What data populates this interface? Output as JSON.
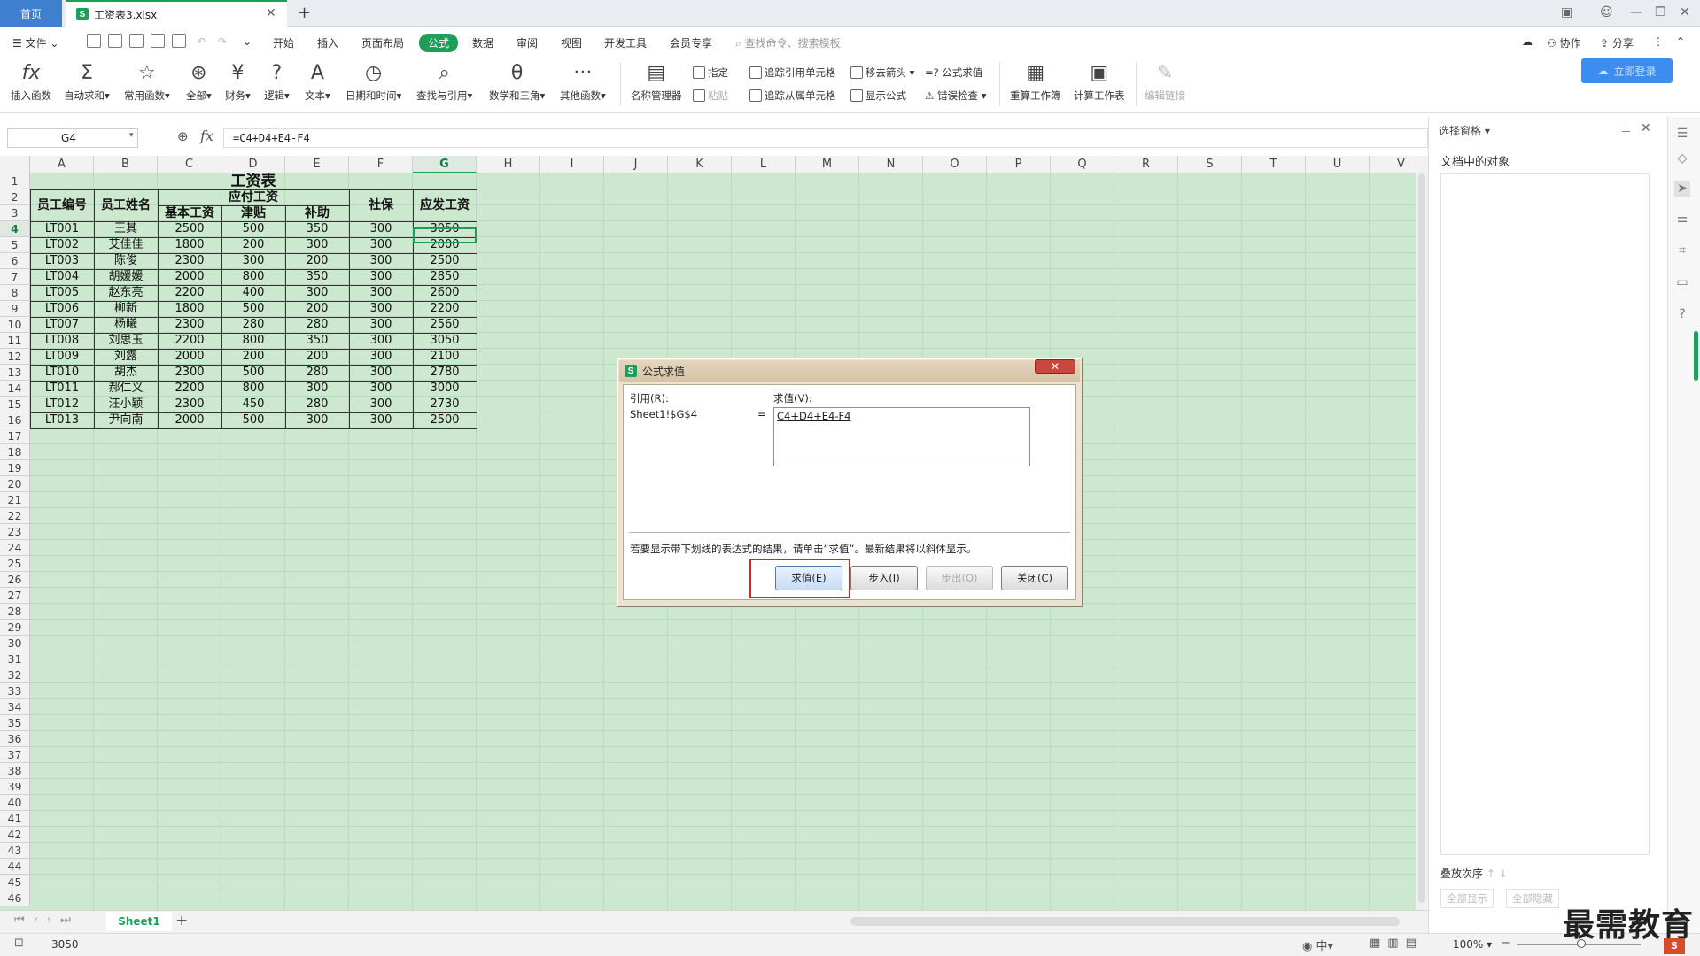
{
  "tabs": {
    "home": "首页",
    "file": "工资表3.xlsx"
  },
  "menu": {
    "file": "文件",
    "items": [
      "开始",
      "插入",
      "页面布局",
      "公式",
      "数据",
      "审阅",
      "视图",
      "开发工具",
      "会员专享"
    ],
    "active": "公式",
    "search": "查找命令、搜索模板",
    "collab": "协作",
    "share": "分享"
  },
  "ribbon": {
    "big": [
      "插入函数",
      "自动求和",
      "常用函数",
      "全部",
      "财务",
      "逻辑",
      "文本",
      "日期和时间",
      "查找与引用",
      "数学和三角",
      "其他函数",
      "名称管理器"
    ],
    "small": {
      "assign": "指定",
      "paste": "粘贴",
      "trace_prec": "追踪引用单元格",
      "trace_dep": "追踪从属单元格",
      "remove_arrows": "移去箭头",
      "show_formula": "显示公式",
      "eval_formula": "=? 公式求值",
      "error_check": "错误检查"
    },
    "calc": [
      "重算工作簿",
      "计算工作表"
    ],
    "edit_links": "编辑链接",
    "login": "立即登录"
  },
  "formula_bar": {
    "name": "G4",
    "formula": "=C4+D4+E4-F4"
  },
  "columns": [
    "A",
    "B",
    "C",
    "D",
    "E",
    "F",
    "G",
    "H",
    "I",
    "J",
    "K",
    "L",
    "M",
    "N",
    "O",
    "P",
    "Q",
    "R",
    "S",
    "T",
    "U",
    "V"
  ],
  "sheet": {
    "title": "工资表",
    "header1": {
      "id": "员工编号",
      "name": "员工姓名",
      "payable": "应付工资",
      "insurance": "社保",
      "net": "应发工资"
    },
    "header2": [
      "基本工资",
      "津贴",
      "补助"
    ],
    "rows": [
      [
        "LT001",
        "王其",
        "2500",
        "500",
        "350",
        "300",
        "3050"
      ],
      [
        "LT002",
        "艾佳佳",
        "1800",
        "200",
        "300",
        "300",
        "2000"
      ],
      [
        "LT003",
        "陈俊",
        "2300",
        "300",
        "200",
        "300",
        "2500"
      ],
      [
        "LT004",
        "胡媛媛",
        "2000",
        "800",
        "350",
        "300",
        "2850"
      ],
      [
        "LT005",
        "赵东亮",
        "2200",
        "400",
        "300",
        "300",
        "2600"
      ],
      [
        "LT006",
        "柳新",
        "1800",
        "500",
        "200",
        "300",
        "2200"
      ],
      [
        "LT007",
        "杨曦",
        "2300",
        "280",
        "280",
        "300",
        "2560"
      ],
      [
        "LT008",
        "刘思玉",
        "2200",
        "800",
        "350",
        "300",
        "3050"
      ],
      [
        "LT009",
        "刘露",
        "2000",
        "200",
        "200",
        "300",
        "2100"
      ],
      [
        "LT010",
        "胡杰",
        "2300",
        "500",
        "280",
        "300",
        "2780"
      ],
      [
        "LT011",
        "郝仁义",
        "2200",
        "800",
        "300",
        "300",
        "3000"
      ],
      [
        "LT012",
        "汪小颖",
        "2300",
        "450",
        "280",
        "300",
        "2730"
      ],
      [
        "LT013",
        "尹向南",
        "2000",
        "500",
        "300",
        "300",
        "2500"
      ]
    ]
  },
  "sheet_tab": "Sheet1",
  "status": {
    "value": "3050",
    "zoom": "100%"
  },
  "right_panel": {
    "title": "选择窗格",
    "subtitle": "文档中的对象",
    "order": "叠放次序",
    "show_all": "全部显示",
    "hide_all": "全部隐藏"
  },
  "dialog": {
    "title": "公式求值",
    "ref_label": "引用(R):",
    "ref_value": "Sheet1!$G$4",
    "eq": "=",
    "eval_label": "求值(V):",
    "eval_value": "C4+D4+E4-F4",
    "message": "若要显示带下划线的表达式的结果，请单击“求值”。最新结果将以斜体显示。",
    "buttons": {
      "evaluate": "求值(E)",
      "step_in": "步入(I)",
      "step_out": "步出(O)",
      "close": "关闭(C)"
    }
  },
  "watermark": "最需教育"
}
